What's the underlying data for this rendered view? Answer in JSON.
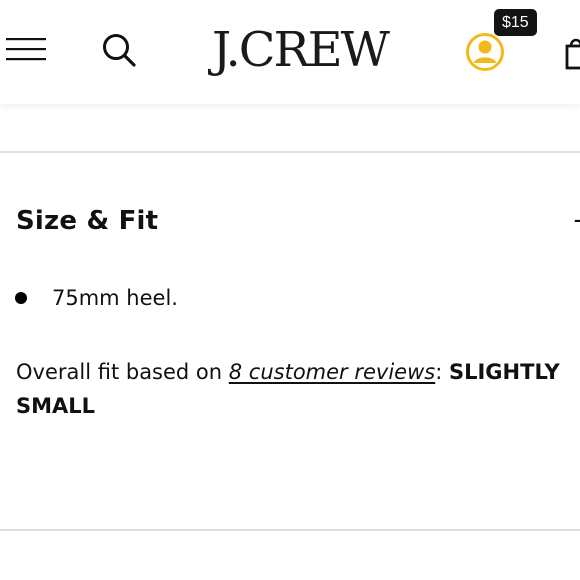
{
  "header": {
    "menu_icon": "hamburger-menu-icon",
    "search_icon": "search-icon",
    "logo_text": "J.CREW",
    "account_icon": "account-icon",
    "credit_badge": "$15",
    "bag_icon": "shopping-bag-icon",
    "accent_color": "#f2b91a"
  },
  "section": {
    "title": "Size & Fit",
    "toggle_symbol": "+",
    "bullets": [
      "75mm heel."
    ],
    "fit": {
      "prefix": "Overall fit based on ",
      "reviews_link": "8 customer reviews",
      "separator": ": ",
      "value": "SLIGHTLY SMALL"
    }
  }
}
